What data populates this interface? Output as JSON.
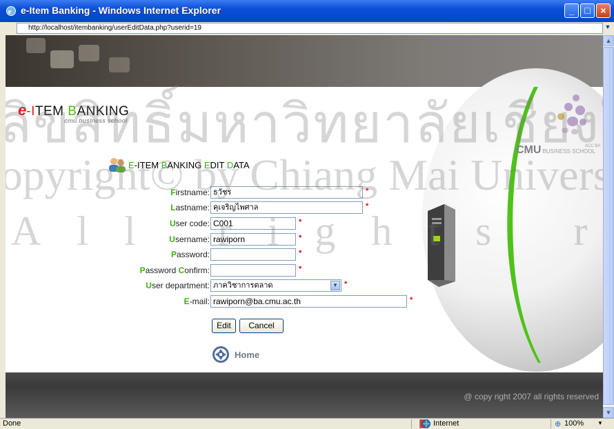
{
  "window": {
    "title": "e-Item Banking - Windows Internet Explorer",
    "url": "http://localhost/itembanking/userEditData.php?userid=19"
  },
  "logo": {
    "letter_e": "e",
    "dash_i": "-I",
    "tem": "TEM ",
    "b": "B",
    "anking": "ANKING",
    "subtitle": "cmu business school"
  },
  "partner_logo": {
    "name": "CMU",
    "sub": "BUSINESS SCHOOL",
    "tag": "ACC BA"
  },
  "form": {
    "title_parts": [
      "E",
      "-I",
      "TEM ",
      "B",
      "ANKING ",
      "E",
      "DIT ",
      "D",
      "ATA"
    ],
    "fields": [
      {
        "initial": "F",
        "rest": "irstname",
        "value": "ธวัชร"
      },
      {
        "initial": "L",
        "rest": "astname",
        "value": "คุเจริญไพศาล"
      },
      {
        "initial": "U",
        "rest": "ser code",
        "value": "C001"
      },
      {
        "initial": "U",
        "rest": "sername",
        "value": "rawiporn"
      },
      {
        "initial": "P",
        "rest": "assword",
        "value": ""
      },
      {
        "initial": "P",
        "rest": "assword ",
        "initial2": "C",
        "rest2": "onfirm",
        "value": ""
      },
      {
        "initial": "U",
        "rest": "ser department",
        "value": "ภาควิชาการตลาด"
      },
      {
        "initial": "E",
        "rest": "-mail",
        "value": "rawiporn@ba.cmu.ac.th"
      }
    ],
    "colon": ":",
    "required_mark": "*",
    "edit_button": "Edit",
    "cancel_button": "Cancel",
    "home_link": "Home"
  },
  "footer": {
    "copyright": "@ copy right 2007 all rights reserved"
  },
  "statusbar": {
    "status": "Done",
    "zone": "Internet",
    "zoom": "100%"
  },
  "watermark": {
    "line1": "ลิขสิทธิ์มหาวิทยาลัยเชียงใหม่",
    "line2": "Copyright© by Chiang Mai University",
    "line3": "All rights reserved"
  },
  "colors": {
    "accent_green": "#3cae17",
    "logo_red": "#e01b1b",
    "titlebar_blue": "#0a4fd6"
  }
}
